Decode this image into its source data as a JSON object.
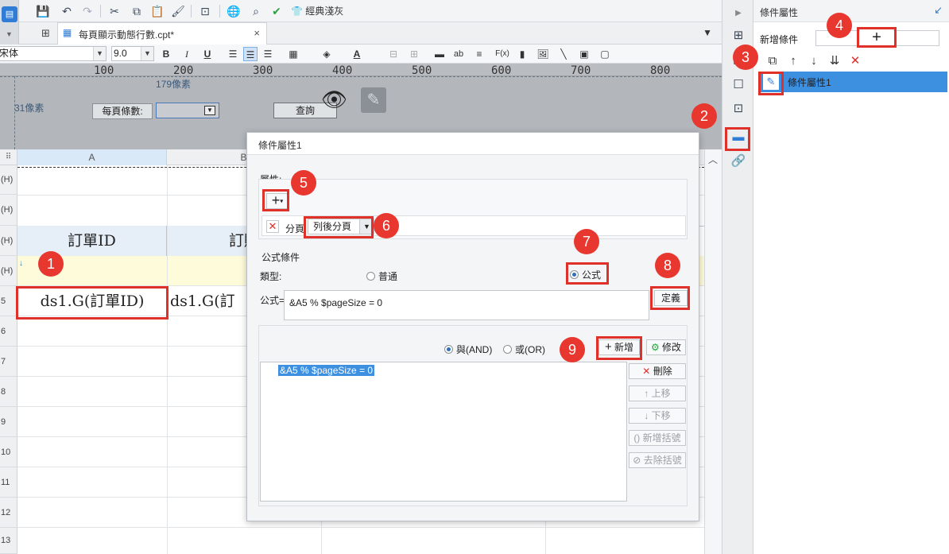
{
  "toolbar": {
    "classic_theme": "經典淺灰"
  },
  "tab": {
    "filename": "每頁顯示動態行數.cpt*",
    "close": "×"
  },
  "format_bar": {
    "font_name": "宋体",
    "font_size": "9.0",
    "bold": "B",
    "italic": "I",
    "underline": "U",
    "abc": "ab",
    "fx": "F(x)"
  },
  "ruler": {
    "marks": [
      "100",
      "200",
      "300",
      "400",
      "500",
      "600",
      "700",
      "800"
    ]
  },
  "param_pane": {
    "width_label": "179像素",
    "height_label": "31像素",
    "rows_per_page_label": "每頁條數:",
    "query_button": "查詢"
  },
  "grid": {
    "columns": [
      "A",
      "B"
    ],
    "row_headers": [
      "(H)",
      "(H)",
      "(H)",
      "(H)",
      "5",
      "6",
      "7",
      "8",
      "9",
      "10",
      "11",
      "12",
      "13"
    ],
    "header_cells": [
      "訂單ID",
      "訂購"
    ],
    "data_cells": [
      "ds1.G(訂單ID)",
      "ds1.G(訂"
    ]
  },
  "right_panel": {
    "title": "條件屬性",
    "add_condition_label": "新增條件",
    "add_plus": "+",
    "condition_item": "條件屬性1"
  },
  "dialog": {
    "title": "條件屬性1",
    "attribute_label": "屬性:",
    "add_attr": "+",
    "paging_label": "分頁",
    "paging_value": "列後分頁",
    "formula_group_label": "公式條件",
    "type_label": "類型:",
    "type_normal": "普通",
    "type_formula": "公式",
    "formula_label": "公式=",
    "formula_value": "&A5 % $pageSize = 0",
    "define_button": "定義",
    "and_label": "與(AND)",
    "or_label": "或(OR)",
    "add_button": "新增",
    "modify_button": "修改",
    "condition_list": [
      "&A5 % $pageSize = 0"
    ],
    "delete_button": "刪除",
    "move_up_button": "上移",
    "move_down_button": "下移",
    "add_bracket_button": "新增括號",
    "remove_bracket_button": "去除括號"
  },
  "annotations": [
    "1",
    "2",
    "3",
    "4",
    "5",
    "6",
    "7",
    "8",
    "9"
  ],
  "colors": {
    "accent": "#2f7dd6",
    "annotation_red": "#e8372f",
    "selected_row": "#3d8fe0",
    "header_cell_bg": "#e6eef7",
    "yellow_row_bg": "#fdfbd9"
  }
}
